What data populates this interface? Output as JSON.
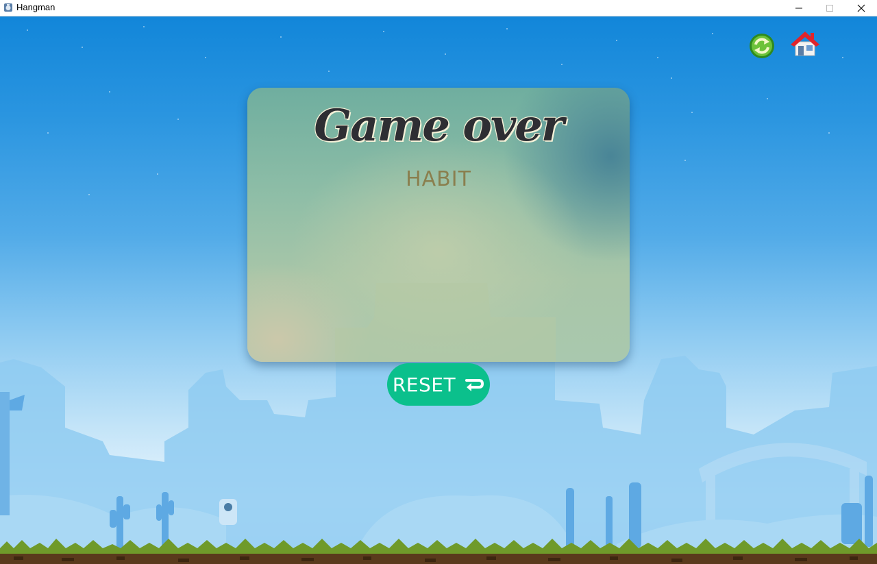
{
  "window": {
    "title": "Hangman",
    "icon": "app-icon"
  },
  "toolbar": {
    "restart_icon": "restart-icon",
    "home_icon": "home-icon"
  },
  "result": {
    "heading": "Game over",
    "word": "HABIT"
  },
  "reset_button": {
    "label": "RESET",
    "icon": "return-arrow-icon"
  },
  "colors": {
    "sky_top": "#1286d9",
    "sky_bottom": "#e8f5fd",
    "reset_button": "#0bc08c",
    "grass": "#6f9a2a",
    "soil": "#5a3a1c",
    "silhouette": "#7cc0ee"
  }
}
